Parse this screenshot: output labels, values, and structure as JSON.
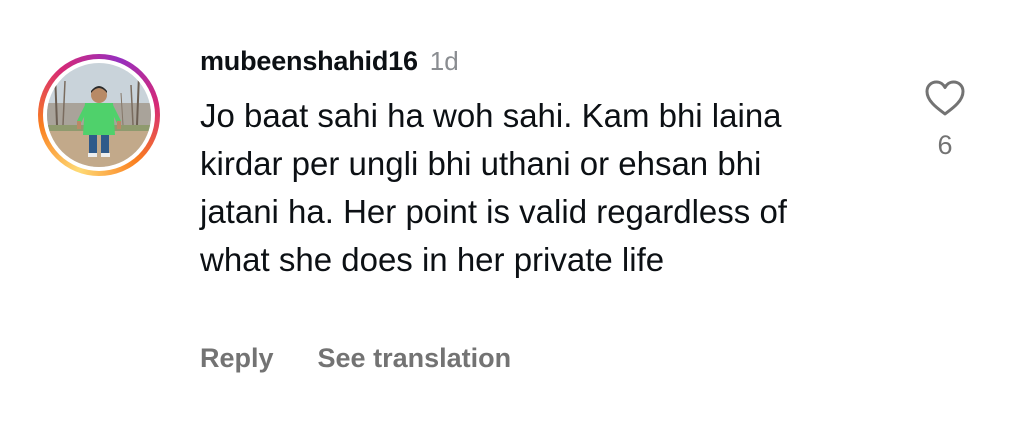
{
  "comment": {
    "username": "mubeenshahid16",
    "time": "1d",
    "text": "Jo baat sahi ha woh sahi. Kam bhi laina kirdar per ungli bhi uthani or ehsan bhi jatani ha. Her point is valid regardless of what she does in her private life",
    "like_count": "6",
    "actions": {
      "reply": "Reply",
      "see_translation": "See translation"
    },
    "icons": {
      "like": "heart-outline-icon"
    }
  },
  "colors": {
    "text_primary": "#0c1014",
    "text_secondary": "#737373",
    "timestamp": "#8a8d91",
    "story_ring": [
      "#feda75",
      "#fa7e1e",
      "#d62976",
      "#962fbf"
    ]
  }
}
